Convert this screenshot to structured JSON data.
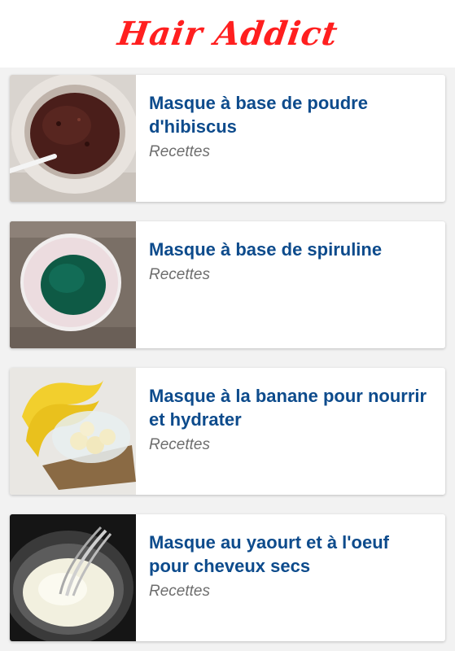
{
  "header": {
    "logo_text": "Hair Addict"
  },
  "articles": [
    {
      "title": "Masque à base de poudre d'hibiscus",
      "category": "Recettes",
      "thumb_icon": "hibiscus-mask-photo"
    },
    {
      "title": "Masque à base de spiruline",
      "category": "Recettes",
      "thumb_icon": "spirulina-mask-photo"
    },
    {
      "title": "Masque à la banane pour nourrir et hydrater",
      "category": "Recettes",
      "thumb_icon": "banana-mask-photo"
    },
    {
      "title": "Masque au yaourt et à l'oeuf pour cheveux secs",
      "category": "Recettes",
      "thumb_icon": "yogurt-egg-mask-photo"
    }
  ],
  "colors": {
    "logo": "#ff1f1f",
    "title": "#0d4b8c",
    "category": "#6e6e6e",
    "background": "#f2f2f2"
  }
}
